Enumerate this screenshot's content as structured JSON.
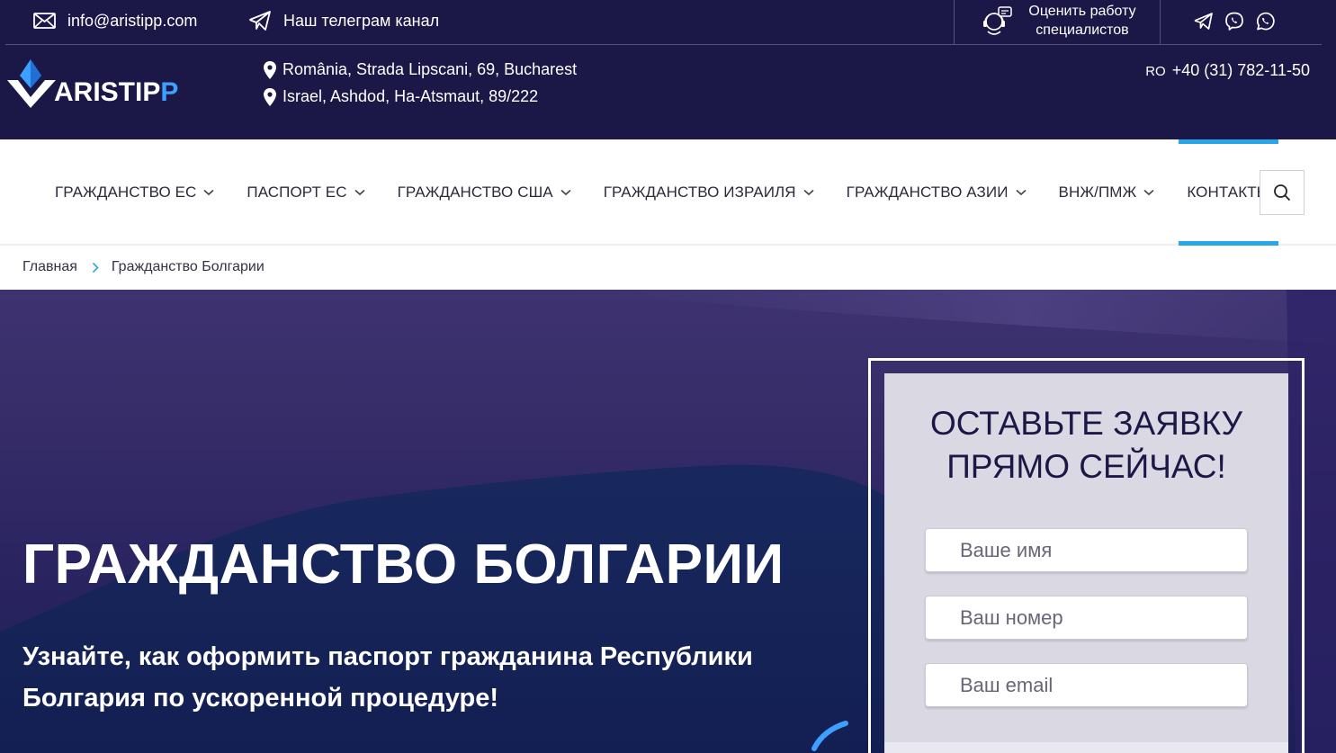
{
  "header": {
    "email": "info@aristipp.com",
    "telegram_channel": "Наш телеграм канал",
    "rate_specialists_line1": "Оценить работу",
    "rate_specialists_line2": "специалистов",
    "socials": [
      "telegram-icon",
      "viber-icon",
      "whatsapp-icon"
    ],
    "logo_text_main": "ARISTIP",
    "logo_text_accent": "P",
    "addresses": [
      "România, Strada Lipscani, 69, Bucharest",
      "Israel, Ashdod, Ha-Atsmaut, 89/222"
    ],
    "phone_country": "RO",
    "phone": "+40 (31) 782-11-50"
  },
  "nav": {
    "items": [
      {
        "label": "ГРАЖДАНСТВО ЕС",
        "has_dropdown": true
      },
      {
        "label": "ПАСПОРТ ЕС",
        "has_dropdown": true
      },
      {
        "label": "ГРАЖДАНСТВО США",
        "has_dropdown": true
      },
      {
        "label": "ГРАЖДАНСТВО ИЗРАИЛЯ",
        "has_dropdown": true
      },
      {
        "label": "ГРАЖДАНСТВО АЗИИ",
        "has_dropdown": true
      },
      {
        "label": "ВНЖ/ПМЖ",
        "has_dropdown": true
      },
      {
        "label": "КОНТАКТЫ",
        "has_dropdown": false,
        "active": true
      }
    ],
    "search_icon": "search-icon"
  },
  "breadcrumb": {
    "home": "Главная",
    "current": "Гражданство Болгарии"
  },
  "hero": {
    "title": "ГРАЖДАНСТВО БОЛГАРИИ",
    "subtitle": "Узнайте, как оформить паспорт гражданина Республики Болгария по ускоренной процедуре!"
  },
  "form": {
    "title_line1": "ОСТАВЬТЕ ЗАЯВКУ",
    "title_line2": "ПРЯМО СЕЙЧАС!",
    "name_placeholder": "Ваше имя",
    "phone_placeholder": "Ваш номер",
    "email_placeholder": "Ваш email"
  },
  "colors": {
    "header_bg": "#1b1746",
    "accent_blue": "#27a7e7",
    "logo_accent": "#3da0ff",
    "form_bg": "#d9d8e3"
  }
}
